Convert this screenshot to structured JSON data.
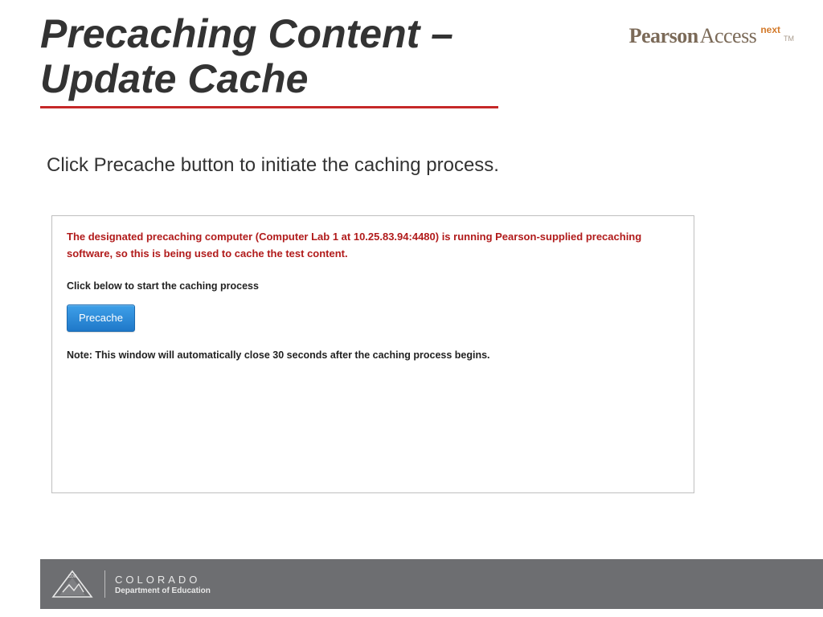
{
  "title": "Precaching Content – Update Cache",
  "brand": {
    "part1": "Pearson",
    "part2": "Access",
    "sup": "next",
    "tm": "TM"
  },
  "instruction": "Click Precache button to initiate the caching process.",
  "panel": {
    "warn": "The designated precaching computer (Computer Lab 1 at 10.25.83.94:4480) is running Pearson-supplied precaching software, so this is being used to cache the test content.",
    "sub": "Click below to start the caching process",
    "button_label": "Precache",
    "note": "Note: This window will automatically close 30 seconds after the caching process begins."
  },
  "footer": {
    "badge": "CDE",
    "state": "COLORADO",
    "dept": "Department of Education"
  }
}
